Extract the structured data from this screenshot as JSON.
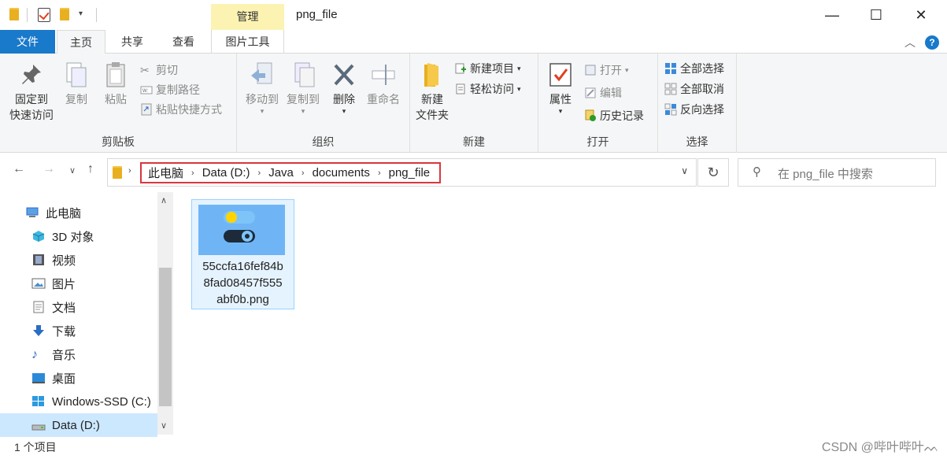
{
  "window": {
    "title": "png_file",
    "manage_tab": "管理"
  },
  "tabs": {
    "file": "文件",
    "home": "主页",
    "share": "共享",
    "view": "查看",
    "picture_tools": "图片工具"
  },
  "ribbon": {
    "clipboard": {
      "label": "剪贴板",
      "pin_line1": "固定到",
      "pin_line2": "快速访问",
      "copy": "复制",
      "paste": "粘贴",
      "cut": "剪切",
      "copy_path": "复制路径",
      "paste_shortcut": "粘贴快捷方式"
    },
    "organize": {
      "label": "组织",
      "move_to": "移动到",
      "copy_to": "复制到",
      "delete": "删除",
      "rename": "重命名"
    },
    "new": {
      "label": "新建",
      "new_folder_line1": "新建",
      "new_folder_line2": "文件夹",
      "new_item": "新建项目",
      "easy_access": "轻松访问"
    },
    "open": {
      "label": "打开",
      "properties": "属性",
      "open": "打开",
      "edit": "编辑",
      "history": "历史记录"
    },
    "select": {
      "label": "选择",
      "select_all": "全部选择",
      "select_none": "全部取消",
      "invert": "反向选择"
    }
  },
  "address": {
    "crumbs": [
      "此电脑",
      "Data (D:)",
      "Java",
      "documents",
      "png_file"
    ],
    "search_placeholder": "在 png_file 中搜索"
  },
  "sidebar": {
    "items": [
      {
        "label": "此电脑",
        "icon": "computer-icon"
      },
      {
        "label": "3D 对象",
        "icon": "cube-icon"
      },
      {
        "label": "视频",
        "icon": "video-icon"
      },
      {
        "label": "图片",
        "icon": "picture-icon"
      },
      {
        "label": "文档",
        "icon": "document-icon"
      },
      {
        "label": "下载",
        "icon": "download-icon"
      },
      {
        "label": "音乐",
        "icon": "music-icon"
      },
      {
        "label": "桌面",
        "icon": "desktop-icon"
      },
      {
        "label": "Windows-SSD (C:)",
        "icon": "windows-drive-icon"
      },
      {
        "label": "Data (D:)",
        "icon": "drive-icon"
      }
    ],
    "selected_index": 9
  },
  "files": [
    {
      "name": "55ccfa16fef84b8fad08457f555abf0b.png",
      "name_lines": [
        "55ccfa16fef84b",
        "8fad08457f555",
        "abf0b.png"
      ]
    }
  ],
  "status": {
    "item_count": "1 个项目"
  },
  "watermark": "CSDN @哔叶哔叶ᨓ",
  "colors": {
    "accent": "#1979ca",
    "manage_tab": "#fcf3b2",
    "highlight_border": "#d9363e",
    "selection": "#cce8ff"
  }
}
